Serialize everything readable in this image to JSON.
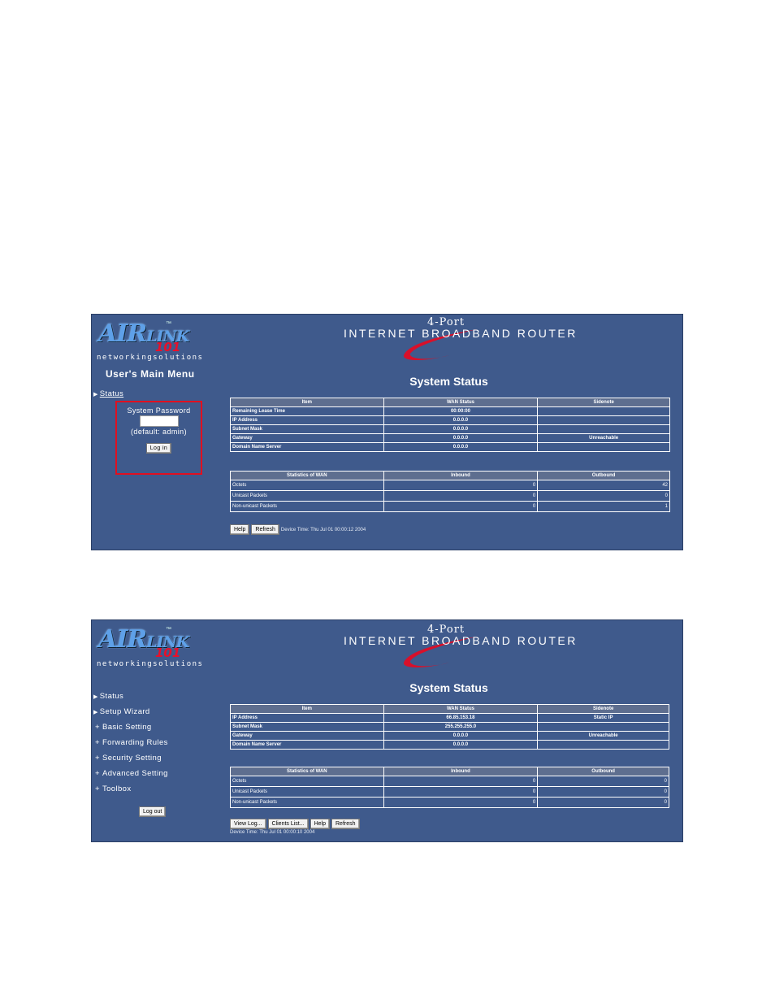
{
  "common": {
    "logo": {
      "main": "AIR",
      "link": "LINK",
      "tm": "™",
      "number": "101",
      "tagline": "networkingsolutions"
    },
    "banner": {
      "small": "4-Port",
      "big": "INTERNET BROADBAND ROUTER"
    },
    "page_title": "System Status",
    "main_headers": [
      "Item",
      "WAN Status",
      "Sidenote"
    ],
    "stats_headers": [
      "Statistics of WAN",
      "Inbound",
      "Outbound"
    ],
    "stats_labels": [
      "Octets",
      "Unicast Packets",
      "Non-unicast Packets"
    ],
    "help_label": "Help",
    "refresh_label": "Refresh",
    "colors": {
      "panel_bg": "#3f5a8c",
      "header_cell": "#5e6e8f",
      "highlight": "#e01020"
    }
  },
  "shot1": {
    "menu_title": "User's Main Menu",
    "nav_status": "Status",
    "login": {
      "label": "System Password",
      "default_note": "(default: admin)",
      "button": "Log in",
      "value": ""
    },
    "main_rows": [
      {
        "item": "Remaining Lease Time",
        "wan": "00:00:00",
        "note": ""
      },
      {
        "item": "IP Address",
        "wan": "0.0.0.0",
        "note": ""
      },
      {
        "item": "Subnet Mask",
        "wan": "0.0.0.0",
        "note": ""
      },
      {
        "item": "Gateway",
        "wan": "0.0.0.0",
        "note": "Unreachable"
      },
      {
        "item": "Domain Name Server",
        "wan": "0.0.0.0",
        "note": ""
      }
    ],
    "stats_in": [
      "0",
      "0",
      "0"
    ],
    "stats_out": [
      "42",
      "0",
      "1"
    ],
    "device_time": "Device Time: Thu Jul 01 00:00:12 2004"
  },
  "shot2": {
    "nav": {
      "status": "Status",
      "setup_wizard": "Setup Wizard",
      "basic": "Basic Setting",
      "forwarding": "Forwarding Rules",
      "security": "Security Setting",
      "advanced": "Advanced Setting",
      "toolbox": "Toolbox"
    },
    "logout_label": "Log out",
    "main_rows": [
      {
        "item": "IP Address",
        "wan": "66.85.153.18",
        "note": "Static IP"
      },
      {
        "item": "Subnet Mask",
        "wan": "255.255.255.0",
        "note": ""
      },
      {
        "item": "Gateway",
        "wan": "0.0.0.0",
        "note": "Unreachable"
      },
      {
        "item": "Domain Name Server",
        "wan": "0.0.0.0",
        "note": ""
      }
    ],
    "stats_in": [
      "0",
      "0",
      "0"
    ],
    "stats_out": [
      "0",
      "0",
      "0"
    ],
    "view_log_label": "View Log...",
    "clients_list_label": "Clients List...",
    "device_time": "Device Time: Thu Jul 01 00:00:10 2004"
  }
}
